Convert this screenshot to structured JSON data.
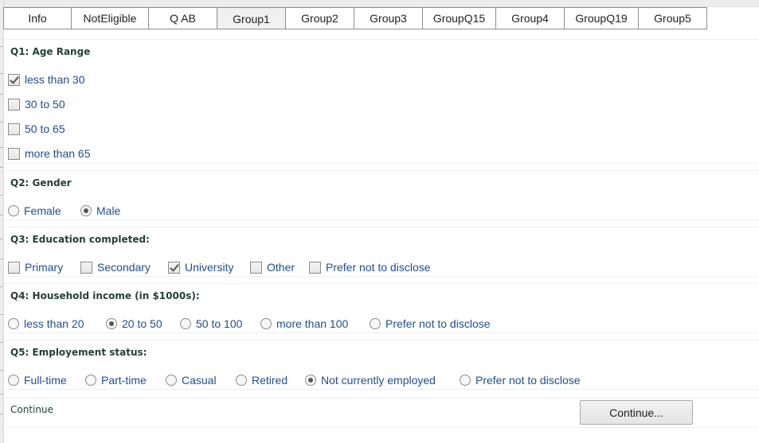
{
  "tabs": [
    {
      "label": "Info",
      "active": false
    },
    {
      "label": "NotEligible",
      "active": false
    },
    {
      "label": "Q AB",
      "active": false
    },
    {
      "label": "Group1",
      "active": true
    },
    {
      "label": "Group2",
      "active": false
    },
    {
      "label": "Group3",
      "active": false
    },
    {
      "label": "GroupQ15",
      "active": false
    },
    {
      "label": "Group4",
      "active": false
    },
    {
      "label": "GroupQ19",
      "active": false
    },
    {
      "label": "Group5",
      "active": false
    }
  ],
  "questions": {
    "q1": {
      "title": "Q1: Age Range",
      "type": "checkbox",
      "options": [
        {
          "label": "less than 30",
          "checked": true
        },
        {
          "label": "30 to 50",
          "checked": false
        },
        {
          "label": "50 to 65",
          "checked": false
        },
        {
          "label": "more than 65",
          "checked": false
        }
      ]
    },
    "q2": {
      "title": "Q2: Gender",
      "type": "radio",
      "options": [
        {
          "label": "Female",
          "checked": false
        },
        {
          "label": "Male",
          "checked": true
        }
      ]
    },
    "q3": {
      "title": "Q3: Education completed:",
      "type": "checkbox",
      "options": [
        {
          "label": "Primary",
          "checked": false
        },
        {
          "label": "Secondary",
          "checked": false
        },
        {
          "label": "University",
          "checked": true
        },
        {
          "label": "Other",
          "checked": false
        },
        {
          "label": "Prefer not to disclose",
          "checked": false
        }
      ]
    },
    "q4": {
      "title": "Q4: Household income (in $1000s):",
      "type": "radio",
      "options": [
        {
          "label": "less than 20",
          "checked": false
        },
        {
          "label": "20 to 50",
          "checked": true
        },
        {
          "label": "50 to 100",
          "checked": false
        },
        {
          "label": "more than 100",
          "checked": false
        },
        {
          "label": "Prefer not to disclose",
          "checked": false
        }
      ]
    },
    "q5": {
      "title": "Q5: Employement status:",
      "type": "radio",
      "options": [
        {
          "label": "Full-time",
          "checked": false
        },
        {
          "label": "Part-time",
          "checked": false
        },
        {
          "label": "Casual",
          "checked": false
        },
        {
          "label": "Retired",
          "checked": false
        },
        {
          "label": "Not currently employed",
          "checked": true
        },
        {
          "label": "Prefer not to disclose",
          "checked": false
        }
      ]
    }
  },
  "footer": {
    "label": "Continue",
    "button_label": "Continue..."
  }
}
